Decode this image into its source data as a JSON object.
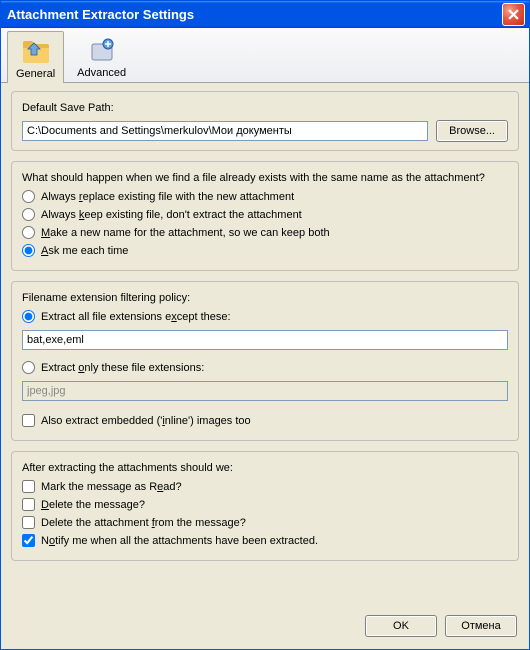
{
  "window": {
    "title": "Attachment Extractor Settings"
  },
  "tabs": {
    "general": "General",
    "advanced": "Advanced"
  },
  "savepath": {
    "label": "Default Save Path:",
    "value": "C:\\Documents and Settings\\merkulov\\Мои документы",
    "browse": "Browse..."
  },
  "overwrite": {
    "question": "What should happen when we find a file already exists with the same name as the attachment?",
    "opt_replace": "Always replace existing file with the new attachment",
    "opt_keep": "Always keep existing file, don't extract the attachment",
    "opt_rename": "Make a new name for the attachment, so we can keep both",
    "opt_ask": "Ask me each time"
  },
  "filter": {
    "label": "Filename extension filtering policy:",
    "opt_except": "Extract all file extensions except these:",
    "value_except": "bat,exe,eml",
    "opt_only": "Extract only these file extensions:",
    "value_only": "jpeg,jpg",
    "inline": "Also extract embedded ('inline') images too"
  },
  "after": {
    "label": "After extracting the attachments should we:",
    "mark_read": "Mark the message as Read?",
    "delete_msg": "Delete the message?",
    "delete_att": "Delete the attachment from the message?",
    "notify": "Notify me when all the attachments have been extracted."
  },
  "buttons": {
    "ok": "OK",
    "cancel": "Отмена"
  }
}
